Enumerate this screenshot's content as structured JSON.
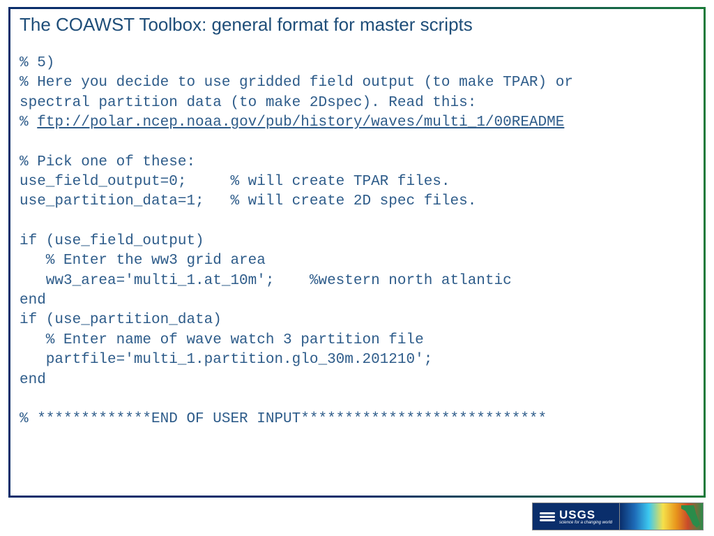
{
  "title": "The COAWST Toolbox: general format for master scripts",
  "code": {
    "line1": "% 5)",
    "line2": "% Here you decide to use gridded field output (to make TPAR) or",
    "line3": "spectral partition data (to make 2Dspec). Read this:",
    "line4_prefix": "% ",
    "line4_link": "ftp://polar.ncep.noaa.gov/pub/history/waves/multi_1/00README",
    "line5": "% Pick one of these:",
    "line6": "use_field_output=0;     % will create TPAR files.",
    "line7": "use_partition_data=1;   % will create 2D spec files.",
    "line8": "if (use_field_output)",
    "line9": "   % Enter the ww3 grid area",
    "line10": "   ww3_area='multi_1.at_10m';    %western north atlantic",
    "line11": "end",
    "line12": "if (use_partition_data)",
    "line13": "   % Enter name of wave watch 3 partition file",
    "line14": "   partfile='multi_1.partition.glo_30m.201210';",
    "line15": "end",
    "line16": "% *************END OF USER INPUT****************************"
  },
  "footer": {
    "usgs_main": "USGS",
    "usgs_sub": "science for a changing world"
  }
}
